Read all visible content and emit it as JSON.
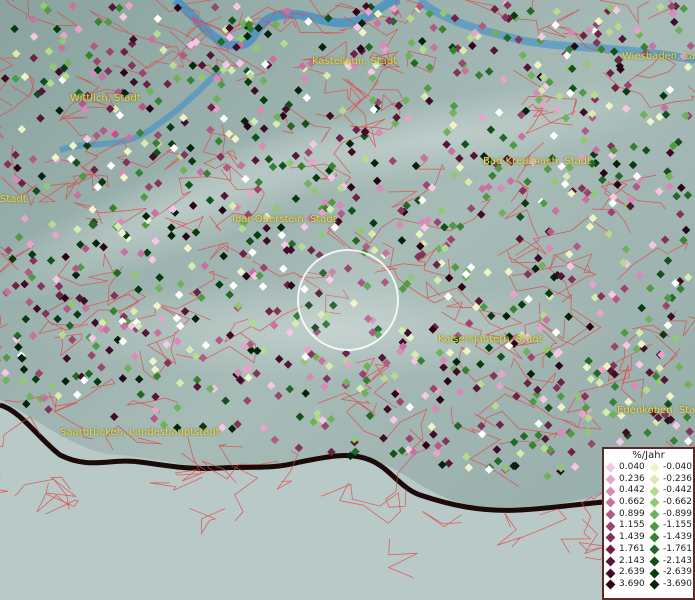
{
  "map": {
    "places": [
      {
        "name": "Kastellaun, Stadt",
        "id": "kastellaun"
      },
      {
        "name": "Wiesbaden, La",
        "id": "wiesbaden"
      },
      {
        "name": "Wittlich, Stadt",
        "id": "wittlich"
      },
      {
        "name": "Bad Kreuznach, Stadt",
        "id": "bad-kreuznach"
      },
      {
        "name": "Stadt",
        "id": "trier"
      },
      {
        "name": "Idar-Oberstein, Stadt",
        "id": "idar-oberstein"
      },
      {
        "name": "Kaiserslautern, Stadt",
        "id": "kaiserslautern"
      },
      {
        "name": "Saarbrücken, Landeshauptstadt",
        "id": "saarbruecken"
      },
      {
        "name": "Edenkoben, Sta",
        "id": "edenkoben"
      }
    ]
  },
  "legend": {
    "title": "%/Jahr",
    "positive": [
      {
        "value": "0.040",
        "color": "#f7c6e6"
      },
      {
        "value": "0.236",
        "color": "#e8a3cd"
      },
      {
        "value": "0.442",
        "color": "#d98ab8"
      },
      {
        "value": "0.662",
        "color": "#c7729f"
      },
      {
        "value": "0.899",
        "color": "#b05a85"
      },
      {
        "value": "1.155",
        "color": "#9a456e"
      },
      {
        "value": "1.439",
        "color": "#84335a"
      },
      {
        "value": "1.761",
        "color": "#6c2346"
      },
      {
        "value": "2.143",
        "color": "#561635"
      },
      {
        "value": "2.639",
        "color": "#410c26"
      },
      {
        "value": "3.690",
        "color": "#2c0418"
      }
    ],
    "negative": [
      {
        "value": "-0.040",
        "color": "#eef4c8"
      },
      {
        "value": "-0.236",
        "color": "#d6ebad"
      },
      {
        "value": "-0.442",
        "color": "#b5db8f"
      },
      {
        "value": "-0.662",
        "color": "#92c873"
      },
      {
        "value": "-0.899",
        "color": "#6fb25a"
      },
      {
        "value": "-1.155",
        "color": "#4f9a44"
      },
      {
        "value": "-1.439",
        "color": "#378133"
      },
      {
        "value": "-1.761",
        "color": "#236826"
      },
      {
        "value": "-2.143",
        "color": "#14501b"
      },
      {
        "value": "-2.639",
        "color": "#0a3a12"
      },
      {
        "value": "-3.690",
        "color": "#03240a"
      }
    ]
  },
  "colors": {
    "water": "#3f8fc8",
    "boundary": "#e04848",
    "coast": "#1a0a0a",
    "sea": "#b9c9c7",
    "label": "#e8d84a"
  }
}
